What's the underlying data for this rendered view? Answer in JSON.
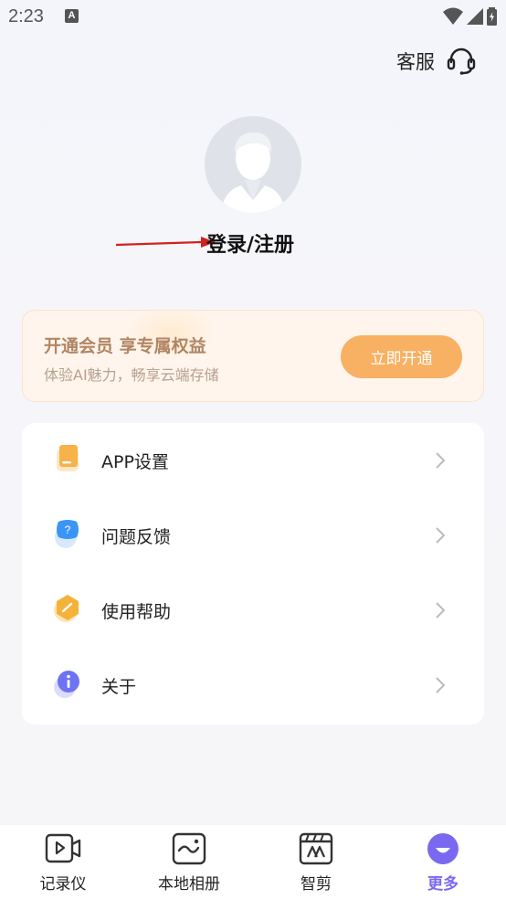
{
  "status_bar": {
    "time": "2:23",
    "notification": "A"
  },
  "header": {
    "service_label": "客服"
  },
  "profile": {
    "login_label": "登录/注册"
  },
  "vip": {
    "title": "开通会员 享专属权益",
    "subtitle": "体验AI魅力，畅享云端存储",
    "button": "立即开通"
  },
  "menu": {
    "items": [
      {
        "label": "APP设置",
        "icon": "settings-icon"
      },
      {
        "label": "问题反馈",
        "icon": "feedback-icon"
      },
      {
        "label": "使用帮助",
        "icon": "help-icon"
      },
      {
        "label": "关于",
        "icon": "info-icon"
      }
    ]
  },
  "nav": {
    "items": [
      {
        "label": "记录仪",
        "active": false
      },
      {
        "label": "本地相册",
        "active": false
      },
      {
        "label": "智剪",
        "active": false
      },
      {
        "label": "更多",
        "active": true
      }
    ]
  },
  "colors": {
    "accent": "#7a69f0",
    "vip_button": "#f8b062",
    "vip_text": "#b08664"
  }
}
